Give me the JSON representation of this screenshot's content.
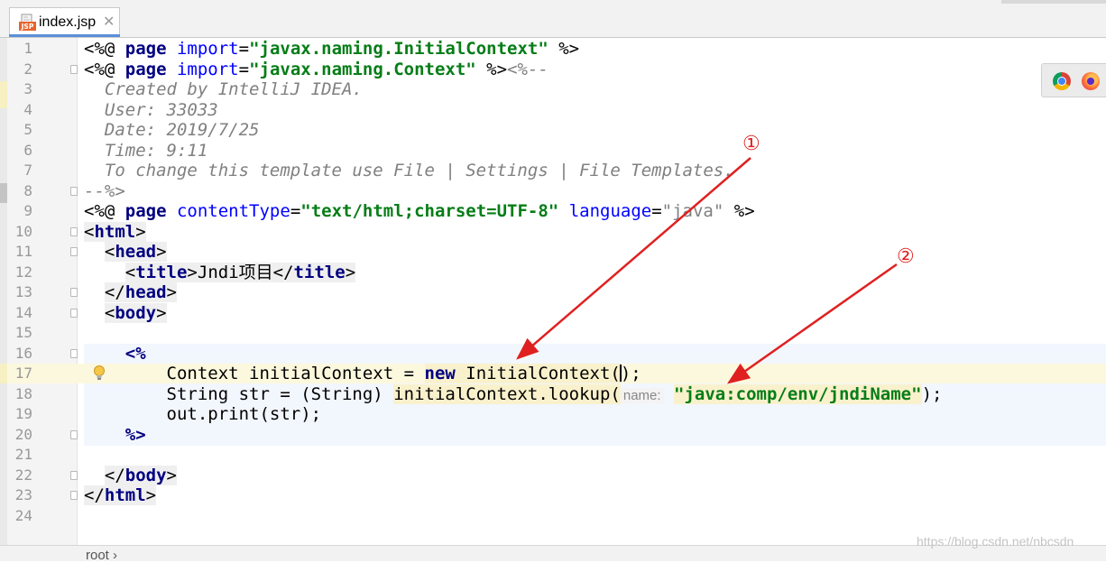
{
  "editor": {
    "tab": {
      "label": "index.jsp",
      "icon": "jsp-file-icon",
      "icon_text": "JSP",
      "close": "✕"
    },
    "line_numbers": [
      "1",
      "2",
      "3",
      "4",
      "5",
      "6",
      "7",
      "8",
      "9",
      "10",
      "11",
      "12",
      "13",
      "14",
      "15",
      "16",
      "17",
      "18",
      "19",
      "20",
      "21",
      "22",
      "23",
      "24"
    ],
    "current_line": 17,
    "lines": {
      "l1": {
        "a": "<%@ ",
        "b": "page ",
        "c": "import",
        "d": "=",
        "e": "\"javax.naming.InitialContext\"",
        "f": " %>"
      },
      "l2": {
        "a": "<%@ ",
        "b": "page ",
        "c": "import",
        "d": "=",
        "e": "\"javax.naming.Context\"",
        "f": " %>",
        "g": "<%--"
      },
      "l3": "  Created by IntelliJ IDEA.",
      "l4": "  User: 33033",
      "l5": "  Date: 2019/7/25",
      "l6": "  Time: 9:11",
      "l7": "  To change this template use File | Settings | File Templates.",
      "l8": "--%>",
      "l9": {
        "a": "<%@ ",
        "b": "page ",
        "c": "contentType",
        "d": "=",
        "e": "\"text/html;charset=UTF-8\"",
        "f": " ",
        "g": "language",
        "h": "=",
        "i": "\"java\"",
        "j": " %>"
      },
      "l10": {
        "a": "<",
        "b": "html",
        "c": ">"
      },
      "l11": {
        "a": "<",
        "b": "head",
        "c": ">"
      },
      "l12": {
        "a": "<",
        "b": "title",
        "c": ">",
        "d": "Jndi项目",
        "e": "</",
        "f": "title",
        "g": ">"
      },
      "l13": {
        "a": "</",
        "b": "head",
        "c": ">"
      },
      "l14": {
        "a": "<",
        "b": "body",
        "c": ">"
      },
      "l16": "<%",
      "l17": {
        "a": "Context initialContext = ",
        "b": "new",
        "c": " InitialContext(",
        "d": ");"
      },
      "l18": {
        "a": "String str = (String) ",
        "b": "initialContext.lookup(",
        "hint": "name:",
        "c": "\"java:comp/env/jndiName\"",
        "d": ");"
      },
      "l19": "out.print(str);",
      "l20": "%>",
      "l22": {
        "a": "</",
        "b": "body",
        "c": ">"
      },
      "l23": {
        "a": "</",
        "b": "html",
        "c": ">"
      }
    }
  },
  "browser_icons": [
    {
      "name": "chrome-icon"
    },
    {
      "name": "firefox-icon"
    }
  ],
  "annotations": [
    {
      "label": "①"
    },
    {
      "label": "②"
    }
  ],
  "status": {
    "breadcrumb": "root  ›"
  },
  "watermark": "https://blog.csdn.net/nbcsdn",
  "colors": {
    "keyword": "#000080",
    "attribute": "#0000ff",
    "string": "#067d17",
    "comment": "#808080",
    "annotation": "#e02020",
    "current_line": "#fcf8de"
  }
}
